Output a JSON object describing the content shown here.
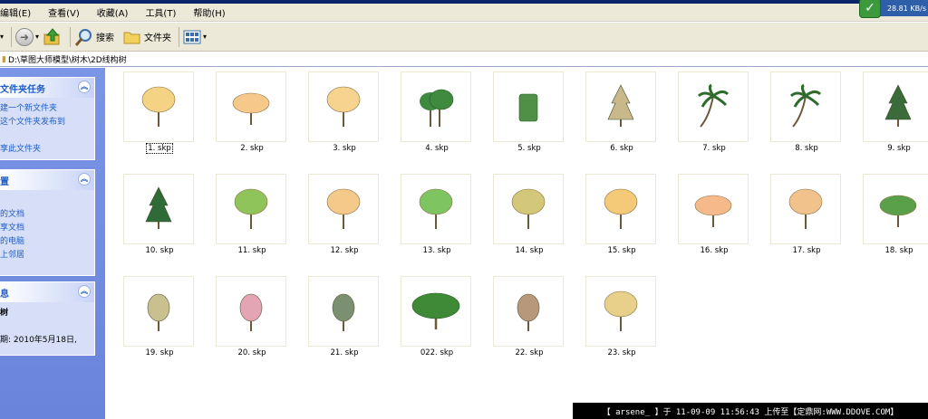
{
  "menu": [
    "编辑(E)",
    "查看(V)",
    "收藏(A)",
    "工具(T)",
    "帮助(H)"
  ],
  "net_speed": "28.81 KB/s",
  "toolbar": {
    "search": "搜索",
    "folders": "文件夹"
  },
  "address": "D:\\草图大师模型\\树木\\2D线构树",
  "side_panels": [
    {
      "title": "文件夹任务",
      "items": [
        "建一个新文件夹",
        "这个文件夹发布到",
        "",
        "享此文件夹"
      ]
    },
    {
      "title": "置",
      "items": [
        "",
        "的文档",
        "享文档",
        "的电脑",
        "上邻居"
      ]
    },
    {
      "title": "息",
      "items": [
        "树",
        "",
        "期: 2010年5月18日,"
      ]
    }
  ],
  "files": [
    {
      "name": "1. skp",
      "tree": "round",
      "color": "#f4d384",
      "selected": true
    },
    {
      "name": "2. skp",
      "tree": "wide",
      "color": "#f6c88a"
    },
    {
      "name": "3. skp",
      "tree": "round",
      "color": "#f6d38e"
    },
    {
      "name": "4. skp",
      "tree": "cluster",
      "color": "#3f8a3f"
    },
    {
      "name": "5. skp",
      "tree": "shrub",
      "color": "#4f8f46"
    },
    {
      "name": "6. skp",
      "tree": "conical",
      "color": "#c9b98a"
    },
    {
      "name": "7. skp",
      "tree": "palm",
      "color": "#2f6b2c"
    },
    {
      "name": "8. skp",
      "tree": "palm",
      "color": "#2f6b2c"
    },
    {
      "name": "9. skp",
      "tree": "conical",
      "color": "#3b6b3a"
    },
    {
      "name": "10. skp",
      "tree": "pine",
      "color": "#2f6b36"
    },
    {
      "name": "11. skp",
      "tree": "round",
      "color": "#8fc45a"
    },
    {
      "name": "12. skp",
      "tree": "round",
      "color": "#f4c98a"
    },
    {
      "name": "13. skp",
      "tree": "round",
      "color": "#7ec460"
    },
    {
      "name": "14. skp",
      "tree": "round",
      "color": "#d3c87a"
    },
    {
      "name": "15. skp",
      "tree": "round",
      "color": "#f4c978"
    },
    {
      "name": "16. skp",
      "tree": "wide",
      "color": "#f5b98a"
    },
    {
      "name": "17. skp",
      "tree": "round",
      "color": "#f2c28c"
    },
    {
      "name": "18. skp",
      "tree": "wide",
      "color": "#5a9f4a"
    },
    {
      "name": "19. skp",
      "tree": "oval",
      "color": "#c8c08e"
    },
    {
      "name": "20. skp",
      "tree": "oval",
      "color": "#e4a4b4"
    },
    {
      "name": "21. skp",
      "tree": "oval",
      "color": "#7a9070"
    },
    {
      "name": "022. skp",
      "tree": "bigwide",
      "color": "#3e8a36"
    },
    {
      "name": "22. skp",
      "tree": "oval",
      "color": "#b8987a"
    },
    {
      "name": "23. skp",
      "tree": "round",
      "color": "#e8d08a"
    }
  ],
  "watermark": "【 arsene_ 】于 11-09-09 11:56:43 上传至【定鼎网:WWW.DDOVE.COM】"
}
